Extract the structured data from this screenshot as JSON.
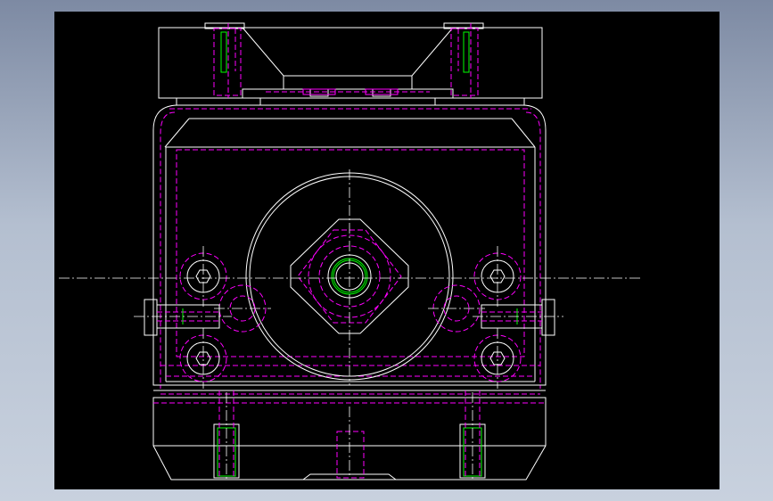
{
  "drawing": {
    "background_color": "#000000",
    "colors": {
      "outline": "#ffffff",
      "hidden": "#ff00ff",
      "thread": "#00ff00"
    },
    "components": [
      "top-clamp-block",
      "main-housing",
      "central-boss",
      "hex-nut",
      "bore",
      "corner-bolts",
      "side-pins",
      "side-set-screws",
      "base-block",
      "base-bolts",
      "center-pocket",
      "centerlines"
    ]
  }
}
